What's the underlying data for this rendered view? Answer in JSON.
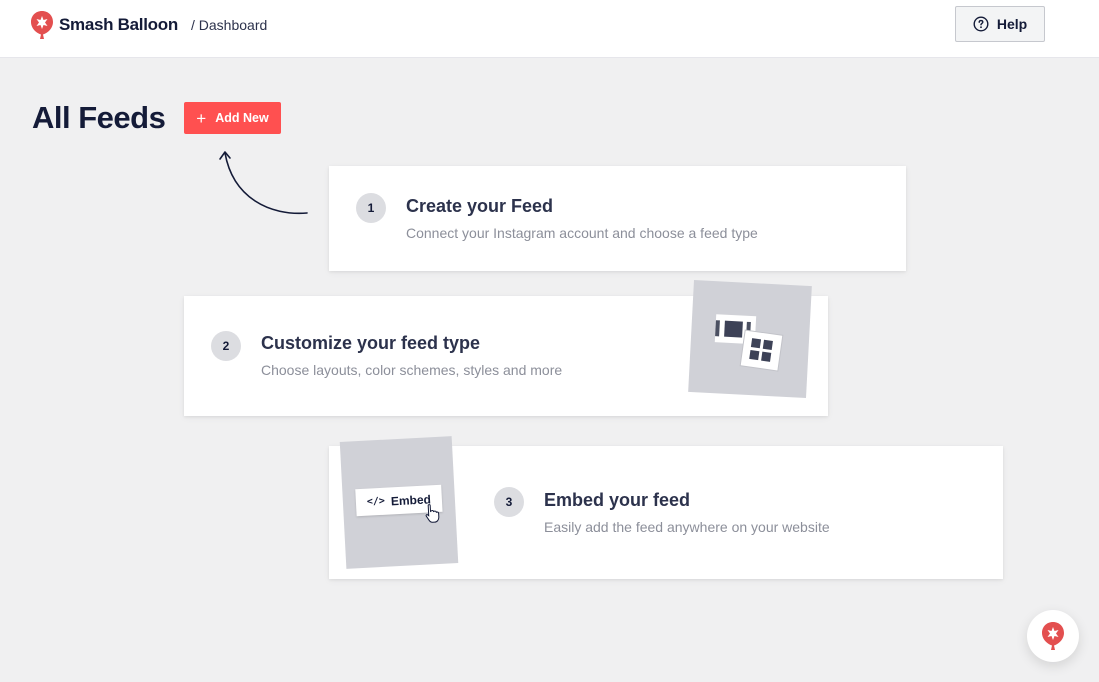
{
  "header": {
    "brand": "Smash Balloon",
    "breadcrumb": "/ Dashboard",
    "help_label": "Help"
  },
  "page": {
    "title": "All Feeds",
    "add_new_label": "Add New"
  },
  "steps": [
    {
      "number": "1",
      "title": "Create your Feed",
      "description": "Connect your Instagram account and choose a feed type"
    },
    {
      "number": "2",
      "title": "Customize your feed type",
      "description": "Choose layouts, color schemes, styles and more"
    },
    {
      "number": "3",
      "title": "Embed your feed",
      "description": "Easily add the feed anywhere on your website"
    }
  ],
  "embed_illustration": {
    "label": "Embed",
    "code_glyph": "</>"
  },
  "colors": {
    "accent": "#ff5050",
    "text_dark": "#141b38",
    "muted": "#8c8f9a",
    "background": "#f0f0f1"
  },
  "icons": [
    "smash-balloon-logo",
    "help-icon",
    "plus-icon",
    "curved-arrow",
    "layout-icon",
    "cursor-icon"
  ]
}
